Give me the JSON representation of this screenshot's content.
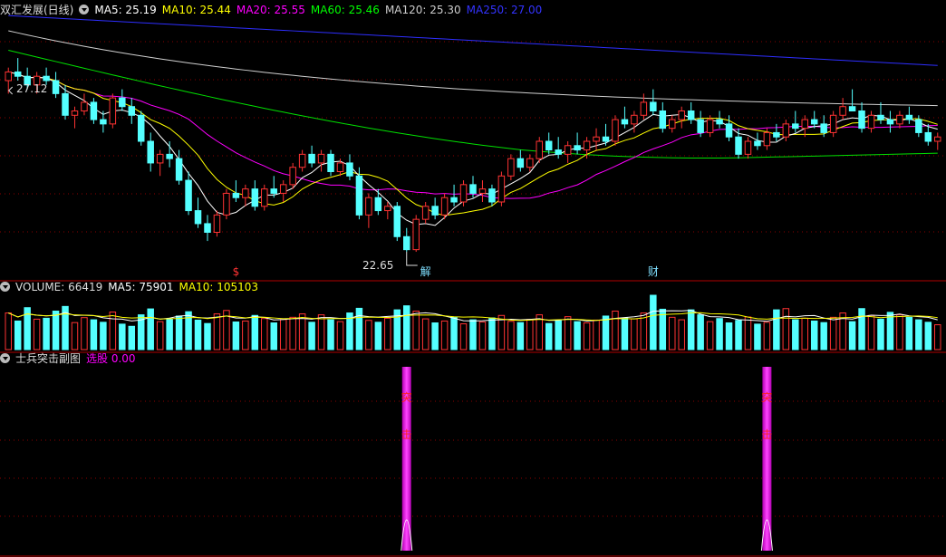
{
  "main_panel": {
    "title": "双汇发展(日线)",
    "indicators": [
      {
        "label": "MA5: 25.19",
        "color": "#ffffff"
      },
      {
        "label": "MA10: 25.44",
        "color": "#ffff00"
      },
      {
        "label": "MA20: 25.55",
        "color": "#ff00ff"
      },
      {
        "label": "MA60: 25.46",
        "color": "#00ff00"
      },
      {
        "label": "MA120: 25.30",
        "color": "#cccccc"
      },
      {
        "label": "MA250: 27.00",
        "color": "#3333ff"
      }
    ],
    "high_label": "27.12",
    "low_label": "22.65",
    "event_tags": [
      {
        "text": "$",
        "color": "#ff3333",
        "at": 24
      },
      {
        "text": "解",
        "color": "#7fdfff",
        "at": 44
      },
      {
        "text": "财",
        "color": "#7fdfff",
        "at": 68
      }
    ]
  },
  "volume_panel": {
    "title": "VOLUME: 66419",
    "indicators": [
      {
        "label": "MA5: 75901",
        "color": "#ffffff"
      },
      {
        "label": "MA10: 105103",
        "color": "#ffff00"
      }
    ]
  },
  "sub_panel": {
    "title": "士兵突击副图",
    "indicators": [
      {
        "label": "选股  0.00",
        "color": "#ff00ff"
      }
    ],
    "signal_text_1": "突",
    "signal_text_2": "击"
  },
  "colors": {
    "up": "#ff3333",
    "down": "#54ffff",
    "signal": "#ff00ff",
    "grid": "#8b0000"
  },
  "chart_data": {
    "type": "candlestick",
    "candles": [
      [
        26.6,
        26.9,
        26.3,
        26.8
      ],
      [
        26.8,
        27.12,
        26.6,
        26.7
      ],
      [
        26.7,
        26.9,
        26.4,
        26.5
      ],
      [
        26.5,
        26.8,
        26.3,
        26.7
      ],
      [
        26.7,
        26.9,
        26.5,
        26.6
      ],
      [
        26.6,
        26.8,
        26.2,
        26.3
      ],
      [
        26.3,
        26.5,
        25.7,
        25.8
      ],
      [
        25.8,
        26.0,
        25.5,
        25.9
      ],
      [
        25.9,
        26.3,
        25.8,
        26.1
      ],
      [
        26.1,
        26.2,
        25.6,
        25.7
      ],
      [
        25.7,
        25.9,
        25.4,
        25.6
      ],
      [
        25.6,
        26.3,
        25.5,
        26.2
      ],
      [
        26.2,
        26.4,
        25.9,
        26.0
      ],
      [
        26.0,
        26.2,
        25.6,
        25.8
      ],
      [
        25.8,
        25.9,
        25.1,
        25.2
      ],
      [
        25.2,
        25.4,
        24.5,
        24.7
      ],
      [
        24.7,
        25.0,
        24.4,
        24.9
      ],
      [
        24.9,
        25.2,
        24.6,
        24.8
      ],
      [
        24.8,
        25.0,
        24.2,
        24.3
      ],
      [
        24.3,
        24.5,
        23.5,
        23.6
      ],
      [
        23.6,
        23.9,
        23.2,
        23.3
      ],
      [
        23.3,
        23.5,
        22.9,
        23.1
      ],
      [
        23.1,
        23.6,
        23.0,
        23.5
      ],
      [
        23.5,
        24.1,
        23.4,
        24.0
      ],
      [
        24.0,
        24.3,
        23.8,
        23.9
      ],
      [
        23.9,
        24.2,
        23.7,
        24.1
      ],
      [
        24.1,
        24.3,
        23.6,
        23.7
      ],
      [
        23.7,
        24.2,
        23.6,
        24.1
      ],
      [
        24.1,
        24.4,
        23.9,
        24.0
      ],
      [
        24.0,
        24.3,
        23.8,
        24.2
      ],
      [
        24.2,
        24.7,
        24.1,
        24.6
      ],
      [
        24.6,
        25.0,
        24.5,
        24.9
      ],
      [
        24.9,
        25.1,
        24.6,
        24.7
      ],
      [
        24.7,
        25.0,
        24.5,
        24.9
      ],
      [
        24.9,
        25.0,
        24.4,
        24.5
      ],
      [
        24.5,
        24.8,
        24.4,
        24.7
      ],
      [
        24.7,
        24.9,
        24.3,
        24.4
      ],
      [
        24.4,
        24.6,
        23.4,
        23.5
      ],
      [
        23.5,
        24.0,
        23.2,
        23.9
      ],
      [
        23.9,
        24.1,
        23.5,
        23.6
      ],
      [
        23.6,
        23.8,
        23.4,
        23.7
      ],
      [
        23.7,
        23.8,
        22.9,
        23.0
      ],
      [
        23.0,
        23.2,
        22.65,
        22.7
      ],
      [
        22.7,
        23.5,
        22.65,
        23.4
      ],
      [
        23.4,
        23.8,
        23.3,
        23.7
      ],
      [
        23.7,
        23.9,
        23.4,
        23.5
      ],
      [
        23.5,
        24.0,
        23.4,
        23.9
      ],
      [
        23.9,
        24.2,
        23.7,
        23.8
      ],
      [
        23.8,
        24.3,
        23.7,
        24.2
      ],
      [
        24.2,
        24.4,
        23.9,
        24.0
      ],
      [
        24.0,
        24.3,
        23.8,
        24.1
      ],
      [
        24.1,
        24.2,
        23.7,
        23.8
      ],
      [
        23.8,
        24.5,
        23.7,
        24.4
      ],
      [
        24.4,
        24.9,
        24.3,
        24.8
      ],
      [
        24.8,
        25.0,
        24.5,
        24.6
      ],
      [
        24.6,
        24.9,
        24.5,
        24.8
      ],
      [
        24.8,
        25.3,
        24.7,
        25.2
      ],
      [
        25.2,
        25.4,
        24.9,
        25.0
      ],
      [
        25.0,
        25.3,
        24.8,
        24.9
      ],
      [
        24.9,
        25.2,
        24.7,
        25.1
      ],
      [
        25.1,
        25.4,
        24.9,
        25.0
      ],
      [
        25.0,
        25.3,
        24.8,
        25.2
      ],
      [
        25.2,
        25.5,
        25.0,
        25.3
      ],
      [
        25.3,
        25.6,
        25.1,
        25.2
      ],
      [
        25.2,
        25.8,
        25.1,
        25.7
      ],
      [
        25.7,
        26.0,
        25.5,
        25.6
      ],
      [
        25.6,
        25.9,
        25.4,
        25.8
      ],
      [
        25.8,
        26.3,
        25.7,
        26.1
      ],
      [
        26.1,
        26.4,
        25.8,
        25.9
      ],
      [
        25.9,
        26.1,
        25.4,
        25.5
      ],
      [
        25.5,
        25.8,
        25.4,
        25.7
      ],
      [
        25.7,
        26.0,
        25.5,
        25.9
      ],
      [
        25.9,
        26.1,
        25.6,
        25.7
      ],
      [
        25.7,
        25.9,
        25.3,
        25.4
      ],
      [
        25.4,
        25.8,
        25.3,
        25.7
      ],
      [
        25.7,
        25.9,
        25.5,
        25.6
      ],
      [
        25.6,
        25.8,
        25.2,
        25.3
      ],
      [
        25.3,
        25.5,
        24.8,
        24.9
      ],
      [
        24.9,
        25.3,
        24.8,
        25.2
      ],
      [
        25.2,
        25.4,
        25.0,
        25.1
      ],
      [
        25.1,
        25.5,
        25.0,
        25.4
      ],
      [
        25.4,
        25.6,
        25.2,
        25.3
      ],
      [
        25.3,
        25.7,
        25.2,
        25.6
      ],
      [
        25.6,
        25.9,
        25.4,
        25.5
      ],
      [
        25.5,
        25.8,
        25.3,
        25.7
      ],
      [
        25.7,
        25.9,
        25.5,
        25.6
      ],
      [
        25.6,
        25.8,
        25.3,
        25.4
      ],
      [
        25.4,
        25.9,
        25.3,
        25.8
      ],
      [
        25.8,
        26.2,
        25.7,
        26.0
      ],
      [
        26.0,
        26.4,
        25.9,
        25.9
      ],
      [
        25.9,
        26.1,
        25.4,
        25.5
      ],
      [
        25.5,
        25.9,
        25.4,
        25.8
      ],
      [
        25.8,
        26.1,
        25.6,
        25.7
      ],
      [
        25.7,
        25.9,
        25.4,
        25.6
      ],
      [
        25.6,
        25.9,
        25.5,
        25.8
      ],
      [
        25.8,
        26.0,
        25.6,
        25.7
      ],
      [
        25.7,
        25.8,
        25.3,
        25.4
      ],
      [
        25.4,
        25.6,
        25.1,
        25.2
      ],
      [
        25.2,
        25.4,
        25.0,
        25.3
      ]
    ],
    "volumes": [
      118000,
      92000,
      135000,
      98000,
      101000,
      124000,
      139000,
      87000,
      103000,
      96000,
      88000,
      121000,
      82000,
      75000,
      112000,
      131000,
      90000,
      99000,
      108000,
      122000,
      95000,
      84000,
      115000,
      126000,
      89000,
      92000,
      110000,
      100000,
      86000,
      97000,
      104000,
      115000,
      88000,
      112000,
      96000,
      90000,
      118000,
      133000,
      94000,
      88000,
      101000,
      128000,
      141000,
      124000,
      99000,
      86000,
      92000,
      105000,
      83000,
      96000,
      89000,
      102000,
      110000,
      91000,
      87000,
      97000,
      112000,
      84000,
      93000,
      106000,
      90000,
      86000,
      95000,
      108000,
      124000,
      102000,
      99000,
      118000,
      175000,
      130000,
      104000,
      96000,
      128000,
      112000,
      90000,
      100000,
      86000,
      94000,
      105000,
      82000,
      88000,
      128000,
      132000,
      96000,
      101000,
      92000,
      87000,
      104000,
      118000,
      90000,
      132000,
      110000,
      98000,
      120000,
      112000,
      104000,
      96000,
      88000,
      80000
    ],
    "signals": [
      42,
      80
    ]
  }
}
